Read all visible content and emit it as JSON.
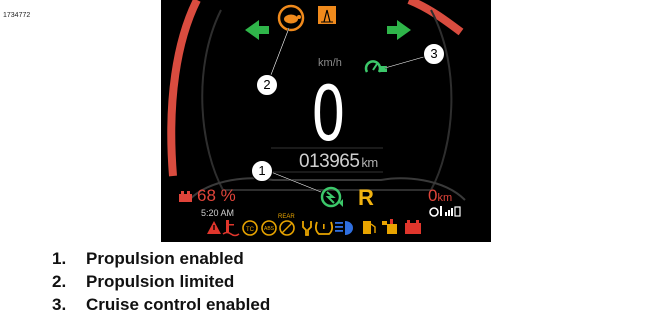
{
  "figure_id": "1734772",
  "cluster": {
    "speed_value": "0",
    "speed_unit": "km/h",
    "odometer_value": "013965",
    "odometer_unit": "km",
    "gear": "R",
    "battery_percent": "68 %",
    "time": "5:20 AM",
    "range_value": "0",
    "range_unit": "km",
    "rear_label": "REAR",
    "colors": {
      "background": "#000000",
      "arc": "#d94c3f",
      "turn_signal": "#2fb54a",
      "warning_orange": "#f08a1c",
      "warning_red": "#e0362c",
      "gear": "#f2b310",
      "indicator_green": "#3cc86a"
    },
    "top_indicators": [
      "left-turn-signal-icon",
      "propulsion-limited-turtle-icon",
      "hazard-warning-icon",
      "right-turn-signal-icon"
    ],
    "bottom_icons": [
      "warning-triangle-icon",
      "coolant-temperature-icon",
      "traction-control-icon",
      "abs-icon",
      "rear-abs-off-icon",
      "service-wrench-icon",
      "tire-pressure-icon",
      "high-beam-icon",
      "fuel-pump-icon",
      "oil-pressure-icon",
      "battery-charge-icon"
    ]
  },
  "callouts": [
    "1",
    "2",
    "3"
  ],
  "legend": [
    {
      "number": "1.",
      "label": "Propulsion enabled"
    },
    {
      "number": "2.",
      "label": "Propulsion limited"
    },
    {
      "number": "3.",
      "label": "Cruise control enabled"
    }
  ]
}
